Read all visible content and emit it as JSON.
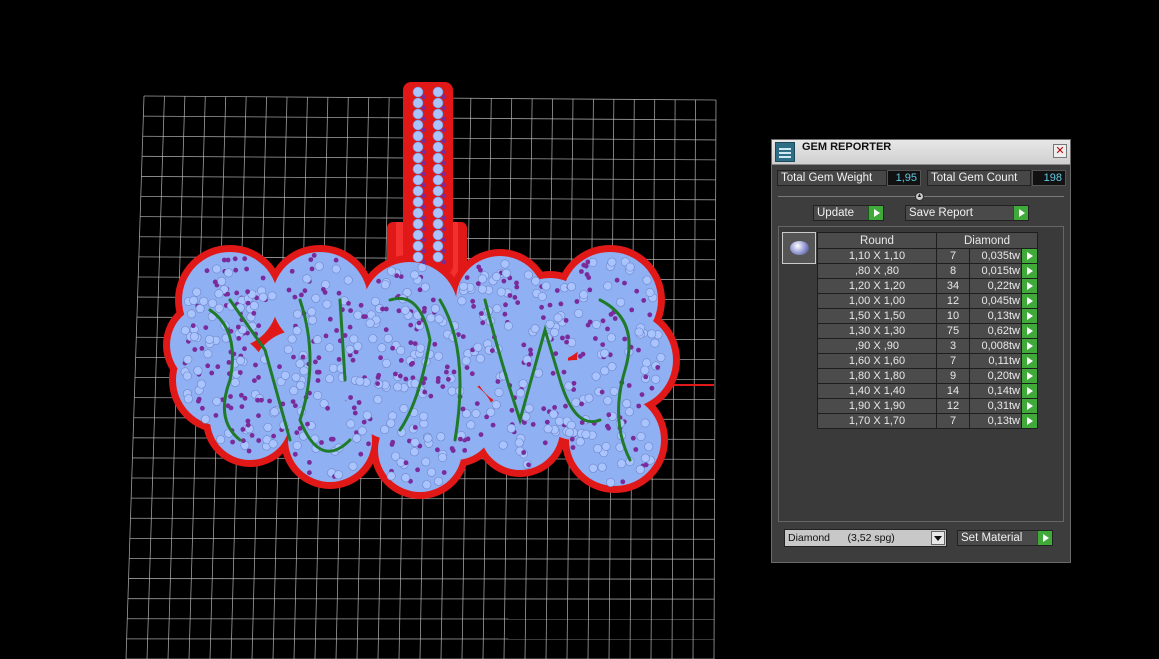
{
  "viewport": {
    "colors": {
      "background": "#000000",
      "grid": "#b8b8b8",
      "metal": "#e01818",
      "gem": "#8fb0f2",
      "prong": "#7a2a9a",
      "channel": "#1f7a2a"
    }
  },
  "panel": {
    "title": "GEM REPORTER",
    "close_icon": "close-icon",
    "total_weight_label": "Total Gem Weight",
    "total_weight_value": "1,95",
    "total_count_label": "Total Gem Count",
    "total_count_value": "198",
    "update_label": "Update",
    "save_report_label": "Save Report",
    "table": {
      "headers": [
        "Round",
        "Diamond"
      ],
      "rows": [
        {
          "size": "1,10 X 1,10",
          "count": "7",
          "weight": "0,035tw"
        },
        {
          "size": ",80 X ,80",
          "count": "8",
          "weight": "0,015tw"
        },
        {
          "size": "1,20 X 1,20",
          "count": "34",
          "weight": "0,22tw"
        },
        {
          "size": "1,00 X 1,00",
          "count": "12",
          "weight": "0,045tw"
        },
        {
          "size": "1,50 X 1,50",
          "count": "10",
          "weight": "0,13tw"
        },
        {
          "size": "1,30 X 1,30",
          "count": "75",
          "weight": "0,62tw"
        },
        {
          "size": ",90 X ,90",
          "count": "3",
          "weight": "0,008tw"
        },
        {
          "size": "1,60 X 1,60",
          "count": "7",
          "weight": "0,11tw"
        },
        {
          "size": "1,80 X 1,80",
          "count": "9",
          "weight": "0,20tw"
        },
        {
          "size": "1,40 X 1,40",
          "count": "14",
          "weight": "0,14tw"
        },
        {
          "size": "1,90 X 1,90",
          "count": "12",
          "weight": "0,31tw"
        },
        {
          "size": "1,70 X 1,70",
          "count": "7",
          "weight": "0,13tw"
        }
      ]
    },
    "material_select": "Diamond      (3,52 spg)",
    "set_material_label": "Set Material"
  }
}
